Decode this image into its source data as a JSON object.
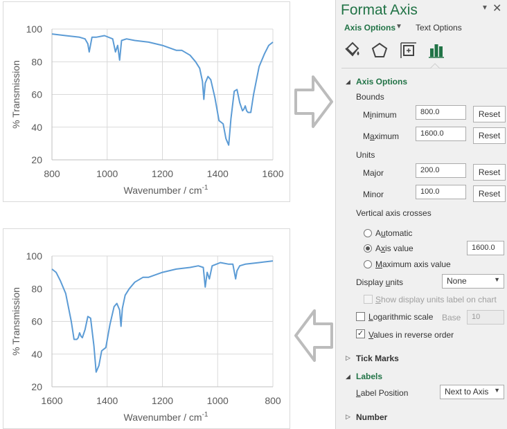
{
  "pane": {
    "title": "Format Axis",
    "pin_icon": "chevron-down-icon",
    "close_icon": "close-icon",
    "tabs": {
      "axis_options": "Axis Options",
      "text_options": "Text Options"
    },
    "icons": [
      "fill-line-icon",
      "effects-pentagon-icon",
      "size-properties-icon",
      "axis-options-bars-icon"
    ],
    "axis_options_header": "Axis Options",
    "bounds_label": "Bounds",
    "minimum_label": "Minimum",
    "minimum_value": "800.0",
    "maximum_label": "Maximum",
    "maximum_value": "1600.0",
    "reset_label": "Reset",
    "units_label": "Units",
    "major_label": "Major",
    "major_value": "200.0",
    "minor_label": "Minor",
    "minor_value": "100.0",
    "crosses_label": "Vertical axis crosses",
    "automatic_label": "Automatic",
    "axis_value_label": "Axis value",
    "axis_value_value": "1600.0",
    "max_axis_label": "Maximum axis value",
    "display_units_label": "Display units",
    "display_units_value": "None",
    "show_units_label": "Show display units label on chart",
    "log_scale_label": "Logarithmic scale",
    "base_label": "Base",
    "base_value": "10",
    "reverse_label": "Values in reverse order",
    "reverse_checked": true,
    "tick_marks_header": "Tick Marks",
    "labels_header": "Labels",
    "label_position_label": "Label Position",
    "label_position_value": "Next to Axis",
    "number_header": "Number",
    "accent_color": "#217346"
  },
  "chart_data": [
    {
      "type": "line",
      "ylabel": "% Transmission",
      "xlabel": "Wavenumber / cm-1",
      "xlim": [
        800,
        1600
      ],
      "ylim": [
        20,
        100
      ],
      "x_reversed": false,
      "xticks": [
        800,
        1000,
        1200,
        1400,
        1600
      ],
      "yticks": [
        20,
        40,
        60,
        80,
        100
      ],
      "grid": true,
      "color": "#5b9bd5",
      "series": [
        {
          "x": [
            800,
            850,
            900,
            920,
            930,
            935,
            945,
            960,
            990,
            1020,
            1030,
            1038,
            1045,
            1052,
            1070,
            1100,
            1150,
            1200,
            1250,
            1270,
            1300,
            1320,
            1335,
            1345,
            1350,
            1355,
            1365,
            1375,
            1390,
            1405,
            1420,
            1430,
            1440,
            1448,
            1460,
            1470,
            1480,
            1490,
            1495,
            1500,
            1505,
            1510,
            1520,
            1530,
            1550,
            1570,
            1585,
            1600
          ],
          "y": [
            97,
            96,
            95,
            94,
            91,
            86,
            95,
            95,
            96,
            94,
            86,
            90,
            81,
            93,
            94,
            93,
            92,
            90,
            87,
            87,
            84,
            80,
            76,
            68,
            57,
            67,
            71,
            69,
            58,
            44,
            42,
            33,
            29,
            45,
            62,
            63,
            55,
            50,
            51,
            53,
            50,
            49,
            49,
            60,
            77,
            85,
            90,
            92
          ]
        }
      ]
    },
    {
      "type": "line",
      "ylabel": "% Transmission",
      "xlabel": "Wavenumber / cm-1",
      "xlim": [
        800,
        1600
      ],
      "ylim": [
        20,
        100
      ],
      "x_reversed": true,
      "xticks": [
        1600,
        1400,
        1200,
        1000,
        800
      ],
      "yticks": [
        20,
        40,
        60,
        80,
        100
      ],
      "grid": true,
      "color": "#5b9bd5",
      "series": [
        {
          "x": [
            800,
            850,
            900,
            920,
            930,
            935,
            945,
            960,
            990,
            1020,
            1030,
            1038,
            1045,
            1052,
            1070,
            1100,
            1150,
            1200,
            1250,
            1270,
            1300,
            1320,
            1335,
            1345,
            1350,
            1355,
            1365,
            1375,
            1390,
            1405,
            1420,
            1430,
            1440,
            1448,
            1460,
            1470,
            1480,
            1490,
            1495,
            1500,
            1505,
            1510,
            1520,
            1530,
            1550,
            1570,
            1585,
            1600
          ],
          "y": [
            97,
            96,
            95,
            94,
            91,
            86,
            95,
            95,
            96,
            94,
            86,
            90,
            81,
            93,
            94,
            93,
            92,
            90,
            87,
            87,
            84,
            80,
            76,
            68,
            57,
            67,
            71,
            69,
            58,
            44,
            42,
            33,
            29,
            45,
            62,
            63,
            55,
            50,
            51,
            53,
            50,
            49,
            49,
            60,
            77,
            85,
            90,
            92
          ]
        }
      ]
    }
  ]
}
